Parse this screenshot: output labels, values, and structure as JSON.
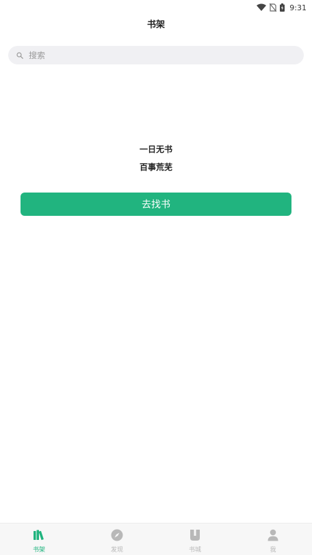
{
  "status_bar": {
    "time": "9:31"
  },
  "header": {
    "title": "书架"
  },
  "search": {
    "placeholder": "搜索"
  },
  "empty_state": {
    "line1": "一日无书",
    "line2": "百事荒芜"
  },
  "find_button": {
    "label": "去找书"
  },
  "bottom_nav": {
    "items": [
      {
        "label": "书架",
        "icon": "bookshelf-icon",
        "active": true
      },
      {
        "label": "发现",
        "icon": "compass-icon",
        "active": false
      },
      {
        "label": "书城",
        "icon": "book-icon",
        "active": false
      },
      {
        "label": "我",
        "icon": "person-icon",
        "active": false
      }
    ]
  },
  "colors": {
    "accent": "#21b47f",
    "inactive": "#b8b8b8",
    "search_bg": "#f0f0f3"
  }
}
